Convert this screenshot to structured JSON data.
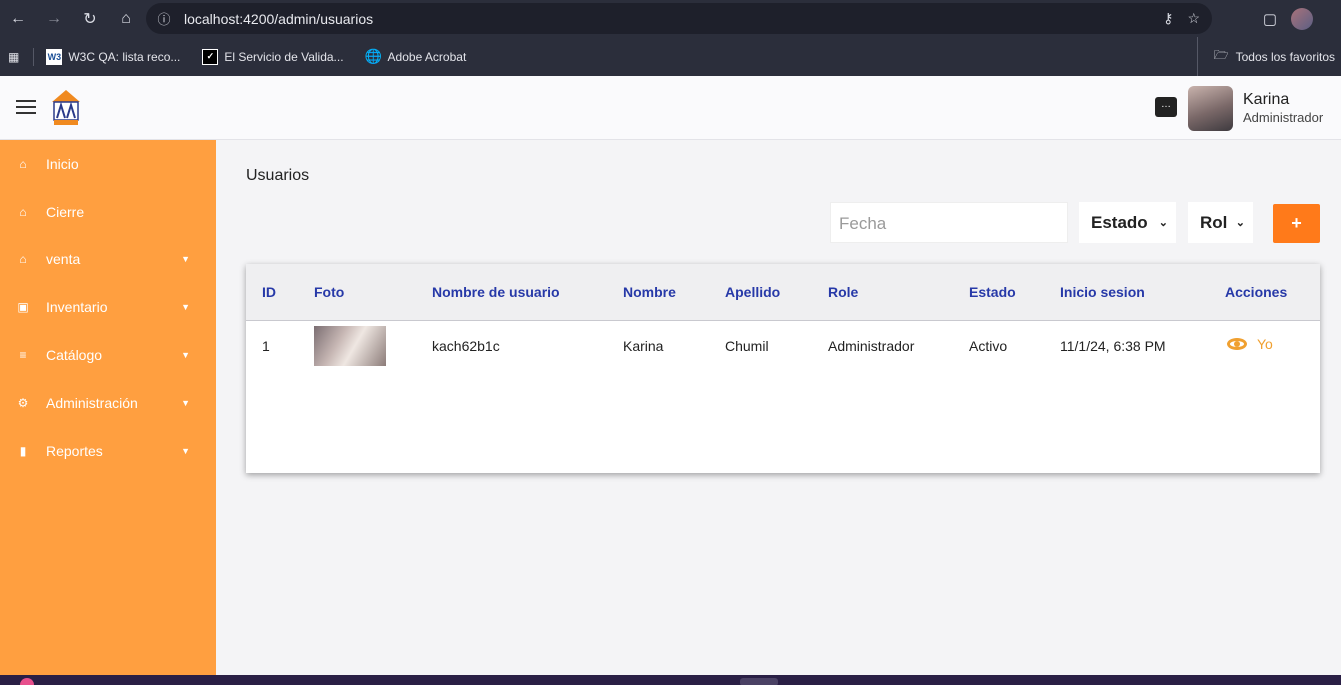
{
  "browser": {
    "url": "localhost:4200/admin/usuarios",
    "bookmarks": [
      {
        "label": "W3C QA: lista reco...",
        "icon": "w3c-icon"
      },
      {
        "label": "El Servicio de Valida...",
        "icon": "validator-icon"
      },
      {
        "label": "Adobe Acrobat",
        "icon": "globe-icon"
      }
    ],
    "all_bookmarks_label": "Todos los favoritos"
  },
  "header": {
    "user_name": "Karina",
    "user_role": "Administrador"
  },
  "sidebar": {
    "items": [
      {
        "label": "Inicio",
        "icon": "home-icon",
        "expandable": false
      },
      {
        "label": "Cierre",
        "icon": "home-icon",
        "expandable": false
      },
      {
        "label": "venta",
        "icon": "home-icon",
        "expandable": true
      },
      {
        "label": "Inventario",
        "icon": "archive-icon",
        "expandable": true
      },
      {
        "label": "Catálogo",
        "icon": "list-icon",
        "expandable": true
      },
      {
        "label": "Administración",
        "icon": "gear-icon",
        "expandable": true
      },
      {
        "label": "Reportes",
        "icon": "bar-chart-icon",
        "expandable": true
      }
    ]
  },
  "main": {
    "title": "Usuarios",
    "filters": {
      "fecha_placeholder": "Fecha",
      "estado_label": "Estado",
      "rol_label": "Rol",
      "add_label": "+"
    },
    "table": {
      "headers": [
        "ID",
        "Foto",
        "Nombre de usuario",
        "Nombre",
        "Apellido",
        "Role",
        "Estado",
        "Inicio sesion",
        "Acciones"
      ],
      "rows": [
        {
          "id": "1",
          "username": "kach62b1c",
          "nombre": "Karina",
          "apellido": "Chumil",
          "role": "Administrador",
          "estado": "Activo",
          "inicio_sesion": "11/1/24, 6:38 PM",
          "accion": "Yo"
        }
      ]
    }
  },
  "colors": {
    "sidebar": "#ff9f40",
    "accent": "#ff7a1a",
    "header_text": "#2739a8",
    "action": "#f0a030"
  }
}
